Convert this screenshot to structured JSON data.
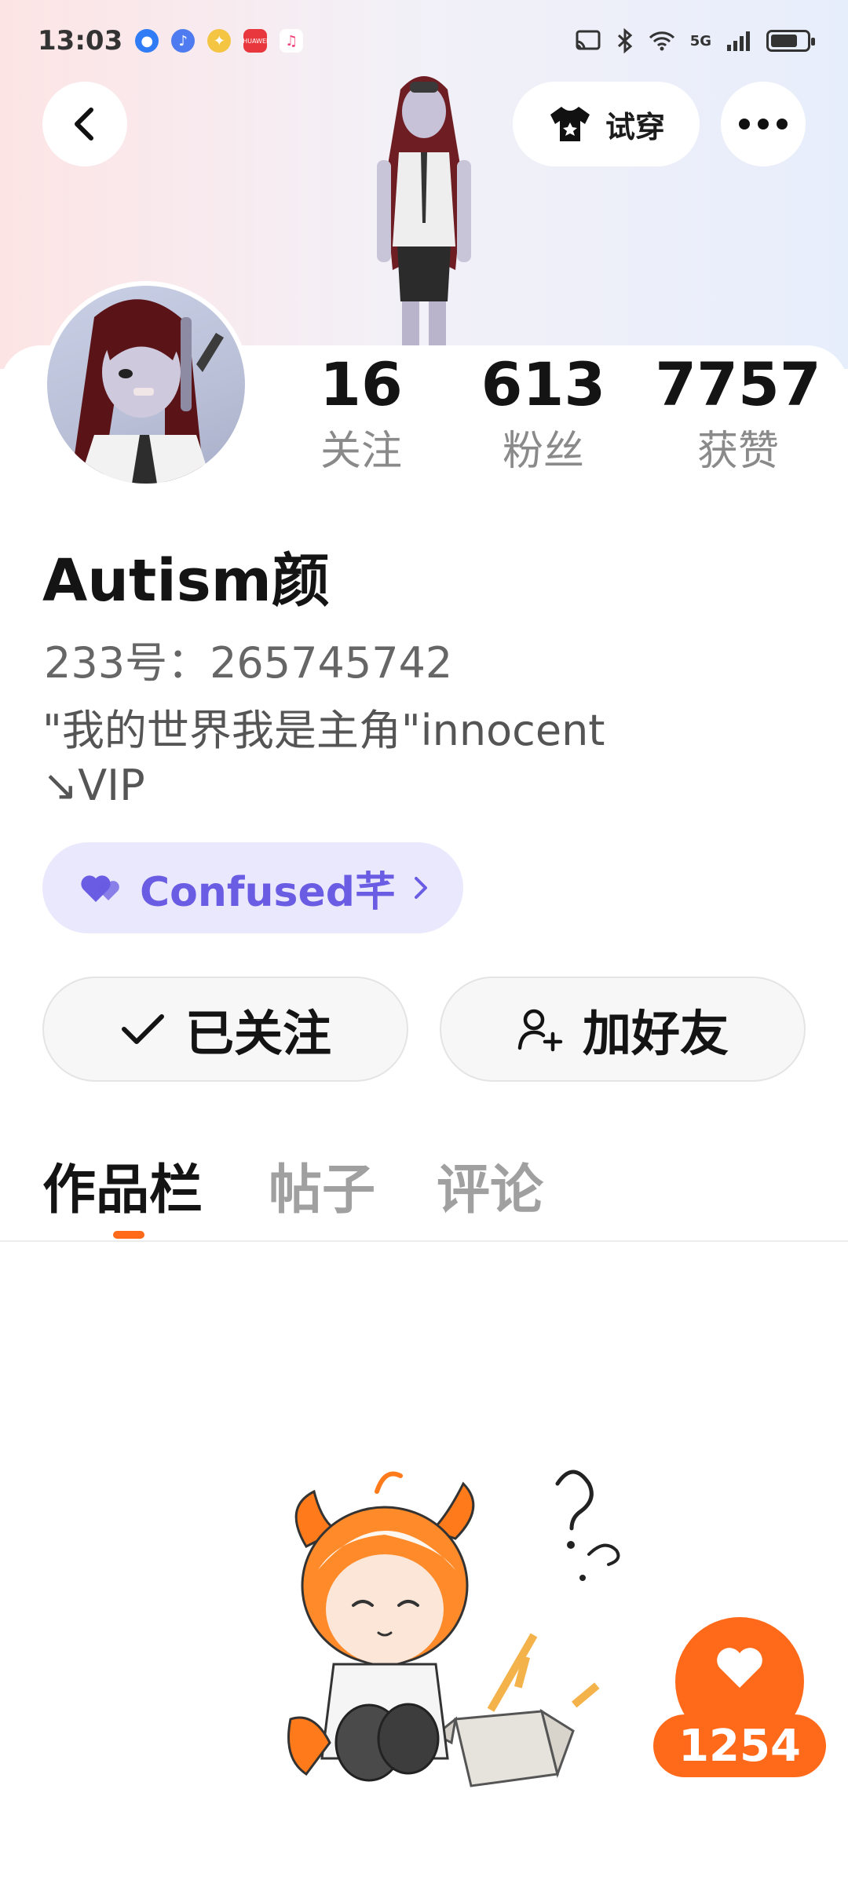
{
  "status_bar": {
    "time": "13:03",
    "network": "5G",
    "app_icons": [
      "app-icon-blue",
      "music-icon",
      "pinwheel-icon",
      "huawei-icon",
      "music-note-icon"
    ],
    "huawei_label": "HUAWEI"
  },
  "header": {
    "try_on_label": "试穿"
  },
  "profile": {
    "stats": [
      {
        "value": "16",
        "label": "关注"
      },
      {
        "value": "613",
        "label": "粉丝"
      },
      {
        "value": "7757",
        "label": "获赞"
      }
    ],
    "name": "Autism颜",
    "uid": "233号：265745742",
    "bio_line1": "\"我的世界我是主角\"innocent",
    "bio_line2": "↘VIP",
    "club_label": "Confused芊"
  },
  "actions": {
    "following_label": "已关注",
    "add_friend_label": "加好友"
  },
  "tabs": [
    {
      "label": "作品栏",
      "active": true
    },
    {
      "label": "帖子",
      "active": false
    },
    {
      "label": "评论",
      "active": false
    }
  ],
  "like_fab": {
    "count": "1254"
  },
  "colors": {
    "accent": "#ff6a1a",
    "club_text": "#6a5ce3",
    "club_bg": "#eae8fc"
  }
}
